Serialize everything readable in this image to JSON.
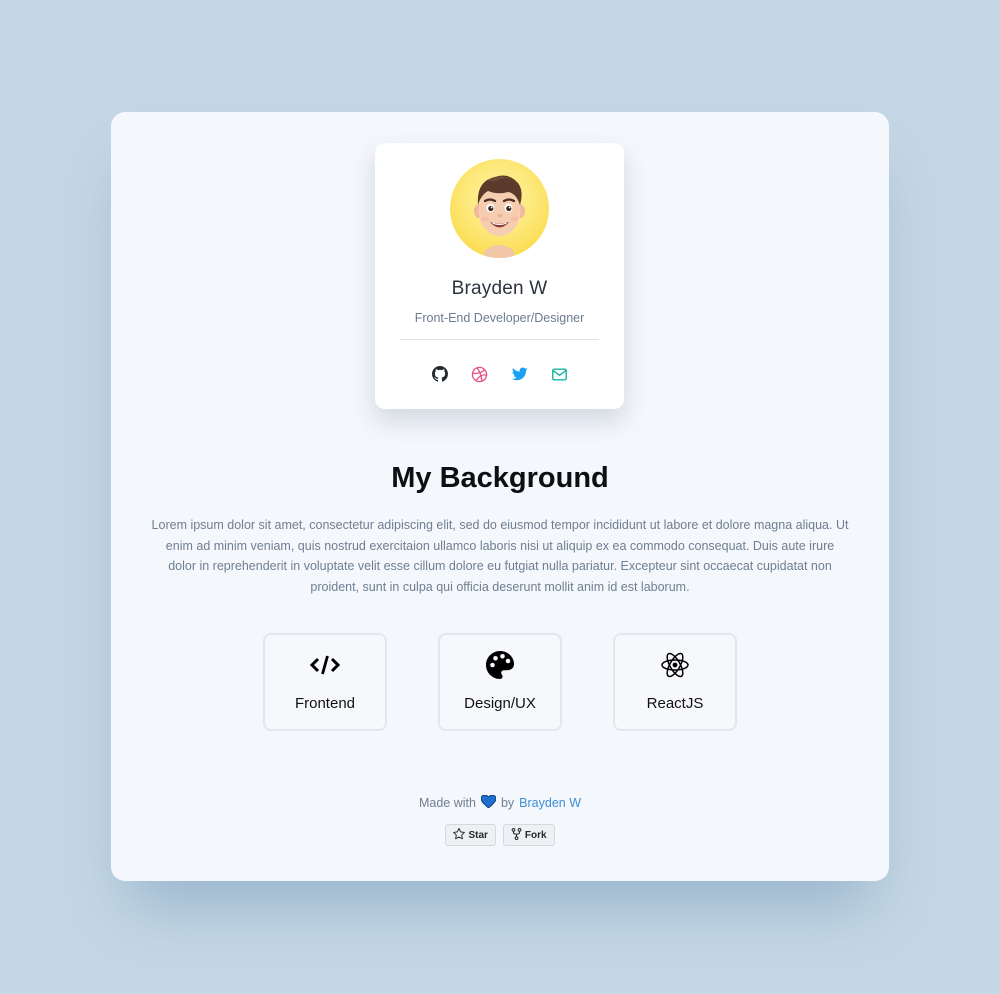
{
  "profile": {
    "name": "Brayden W",
    "role": "Front-End Developer/Designer",
    "socials": [
      {
        "icon": "github-icon",
        "color": "#24292e"
      },
      {
        "icon": "dribbble-icon",
        "color": "#ea4c89"
      },
      {
        "icon": "twitter-icon",
        "color": "#1da1f2"
      },
      {
        "icon": "mail-icon",
        "color": "#1ab7a0"
      }
    ]
  },
  "section": {
    "heading": "My Background",
    "paragraph": "Lorem ipsum dolor sit amet, consectetur adipiscing elit, sed do eiusmod tempor incididunt ut labore et dolore magna aliqua. Ut enim ad minim veniam, quis nostrud exercitaion ullamco laboris nisi ut aliquip ex ea commodo consequat. Duis aute irure dolor in reprehenderit in voluptate velit esse cillum dolore eu futgiat nulla pariatur. Excepteur sint occaecat cupidatat non proident, sunt in culpa qui officia deserunt mollit anim id est laborum."
  },
  "skills": [
    {
      "label": "Frontend",
      "icon": "code-icon"
    },
    {
      "label": "Design/UX",
      "icon": "palette-icon"
    },
    {
      "label": "ReactJS",
      "icon": "react-icon"
    }
  ],
  "footer": {
    "made_with": "Made with",
    "by": "by",
    "author": "Brayden W",
    "heart_color": "#1f6fd1",
    "star_label": "Star",
    "fork_label": "Fork"
  },
  "colors": {
    "background": "#c4d7e4",
    "panel": "#f4f7fb",
    "link": "#3b8ed6"
  }
}
